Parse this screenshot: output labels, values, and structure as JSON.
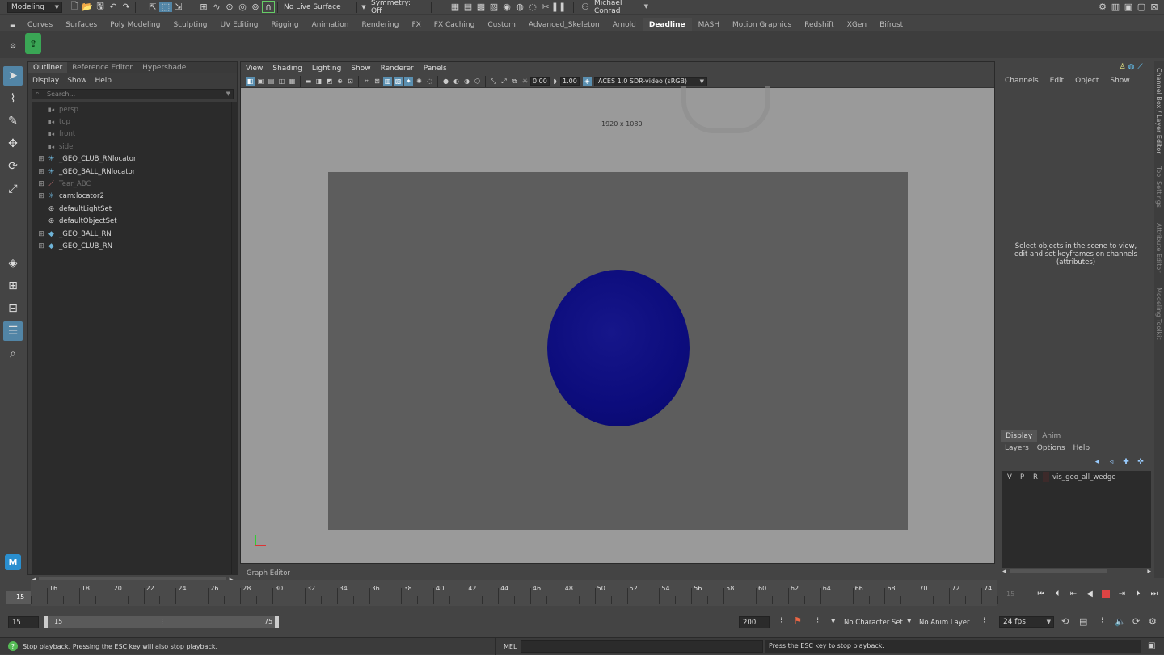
{
  "status_line": {
    "menu_set": "Modeling",
    "live_surface": "No Live Surface",
    "symmetry": "Symmetry: Off",
    "user": "Michael Conrad"
  },
  "shelf_tabs": [
    {
      "label": "Curves"
    },
    {
      "label": "Surfaces"
    },
    {
      "label": "Poly Modeling"
    },
    {
      "label": "Sculpting"
    },
    {
      "label": "UV Editing"
    },
    {
      "label": "Rigging"
    },
    {
      "label": "Animation"
    },
    {
      "label": "Rendering"
    },
    {
      "label": "FX"
    },
    {
      "label": "FX Caching"
    },
    {
      "label": "Custom"
    },
    {
      "label": "Advanced_Skeleton"
    },
    {
      "label": "Arnold"
    },
    {
      "label": "Deadline"
    },
    {
      "label": "MASH"
    },
    {
      "label": "Motion Graphics"
    },
    {
      "label": "Redshift"
    },
    {
      "label": "XGen"
    },
    {
      "label": "Bifrost"
    }
  ],
  "active_shelf_tab": "Deadline",
  "outliner": {
    "tabs": [
      "Outliner",
      "Reference Editor",
      "Hypershade"
    ],
    "menu": [
      "Display",
      "Show",
      "Help"
    ],
    "search_placeholder": "Search...",
    "items": [
      {
        "label": "persp",
        "icon": "camera-icon",
        "dim": true,
        "expand": ""
      },
      {
        "label": "top",
        "icon": "camera-icon",
        "dim": true,
        "expand": ""
      },
      {
        "label": "front",
        "icon": "camera-icon",
        "dim": true,
        "expand": ""
      },
      {
        "label": "side",
        "icon": "camera-icon",
        "dim": true,
        "expand": ""
      },
      {
        "label": "_GEO_CLUB_RNlocator",
        "icon": "locator-icon",
        "dim": false,
        "expand": "⊞"
      },
      {
        "label": "_GEO_BALL_RNlocator",
        "icon": "locator-icon",
        "dim": false,
        "expand": "⊞"
      },
      {
        "label": "Tear_ABC",
        "icon": "transform-icon",
        "dim": true,
        "expand": "⊞"
      },
      {
        "label": "cam:locator2",
        "icon": "locator-icon",
        "dim": false,
        "expand": "⊞"
      },
      {
        "label": "defaultLightSet",
        "icon": "set-icon",
        "dim": false,
        "expand": ""
      },
      {
        "label": "defaultObjectSet",
        "icon": "set-icon",
        "dim": false,
        "expand": ""
      },
      {
        "label": "_GEO_BALL_RN",
        "icon": "reference-icon",
        "dim": false,
        "expand": "⊞"
      },
      {
        "label": "_GEO_CLUB_RN",
        "icon": "reference-icon",
        "dim": false,
        "expand": "⊞"
      }
    ]
  },
  "viewport": {
    "menu": [
      "View",
      "Shading",
      "Lighting",
      "Show",
      "Renderer",
      "Panels"
    ],
    "exposure": "0.00",
    "gamma": "1.00",
    "color_space": "ACES 1.0 SDR-video (sRGB)",
    "resolution": "1920 x 1080",
    "bottom_label": "Graph Editor"
  },
  "channel_box": {
    "menu": [
      "Channels",
      "Edit",
      "Object",
      "Show"
    ],
    "message": "Select objects in the scene to view, edit and set keyframes on channels (attributes)"
  },
  "side_tabs": [
    "Channel Box / Layer Editor",
    "Tool Settings",
    "Attribute Editor",
    "Modeling Toolkit"
  ],
  "layer_editor": {
    "tabs": [
      "Display",
      "Anim"
    ],
    "menu": [
      "Layers",
      "Options",
      "Help"
    ],
    "layer": {
      "v": "V",
      "p": "P",
      "r": "R",
      "name": "vis_geo_all_wedge"
    }
  },
  "time_slider": {
    "current_frame": "15",
    "labels": [
      "16",
      "18",
      "20",
      "22",
      "24",
      "26",
      "28",
      "30",
      "32",
      "34",
      "36",
      "38",
      "40",
      "42",
      "44",
      "46",
      "48",
      "50",
      "52",
      "54",
      "56",
      "58",
      "60",
      "62",
      "64",
      "66",
      "68",
      "70",
      "72",
      "74"
    ],
    "end_label": "15"
  },
  "range": {
    "start": "15",
    "range_start": "15",
    "range_end": "75",
    "end": "200",
    "character_set": "No Character Set",
    "anim_layer": "No Anim Layer",
    "fps": "24 fps"
  },
  "command_line": {
    "help_left": "Stop playback. Pressing the ESC key will also stop playback.",
    "lang": "MEL",
    "help_right": "Press the ESC key to stop playback."
  },
  "colors": {
    "accent": "#5285a6",
    "ball": "#0c0c7c",
    "stop": "#dd4444"
  }
}
